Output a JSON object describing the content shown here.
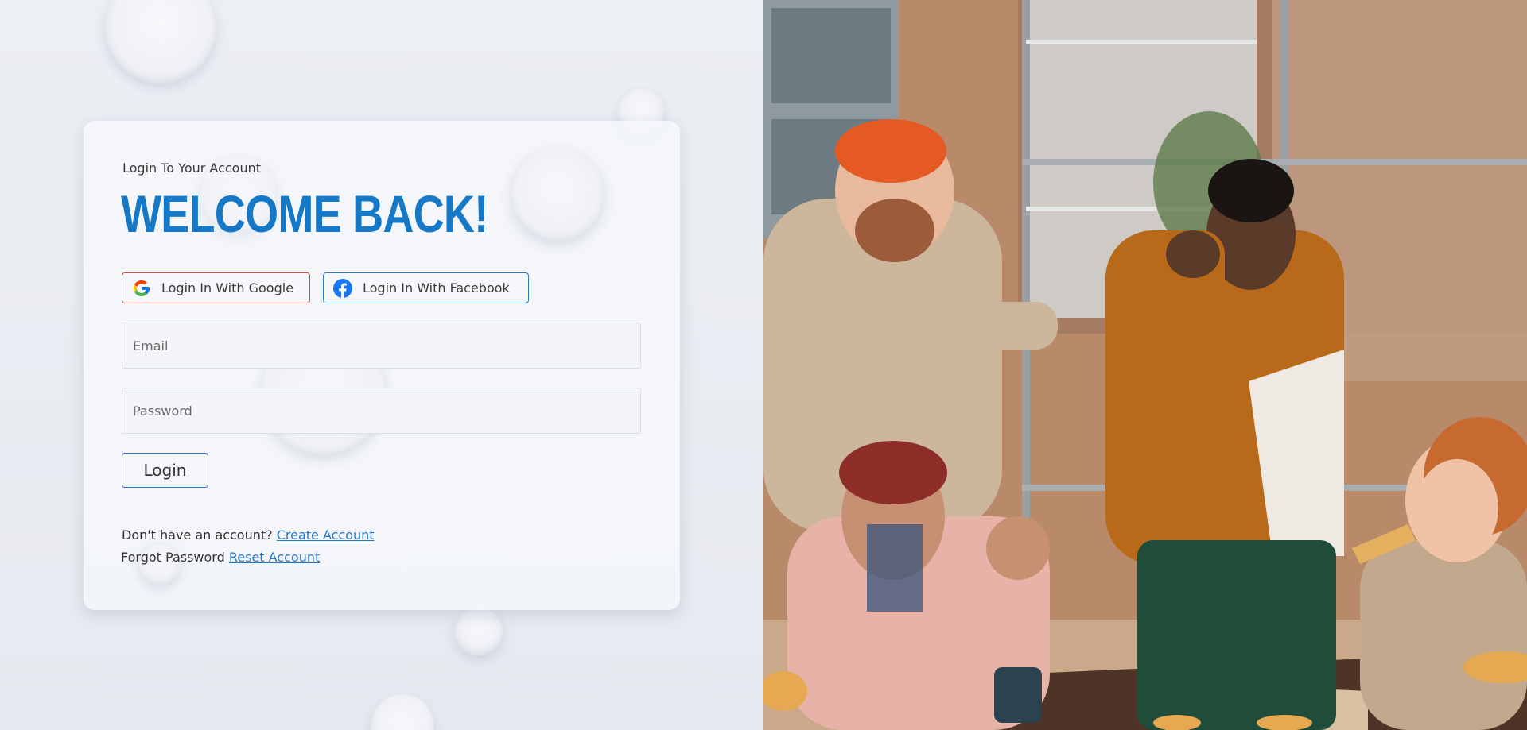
{
  "login": {
    "subtitle": "Login To Your Account",
    "heading": "WELCOME BACK!",
    "google_label": "Login In With Google",
    "facebook_label": "Login In With Facebook",
    "email_placeholder": "Email",
    "email_value": "",
    "password_placeholder": "Password",
    "password_value": "",
    "login_button": "Login",
    "signup_prompt": "Don't have an account?",
    "signup_link": "Create Account",
    "forgot_prompt": "Forgot Password",
    "forgot_link": "Reset Account"
  },
  "icons": {
    "google": "google-icon",
    "facebook": "facebook-icon"
  },
  "colors": {
    "accent": "#1679c8",
    "google_border": "#d9413b",
    "facebook_border": "#2a77c5",
    "background": "#e9ecf2"
  }
}
